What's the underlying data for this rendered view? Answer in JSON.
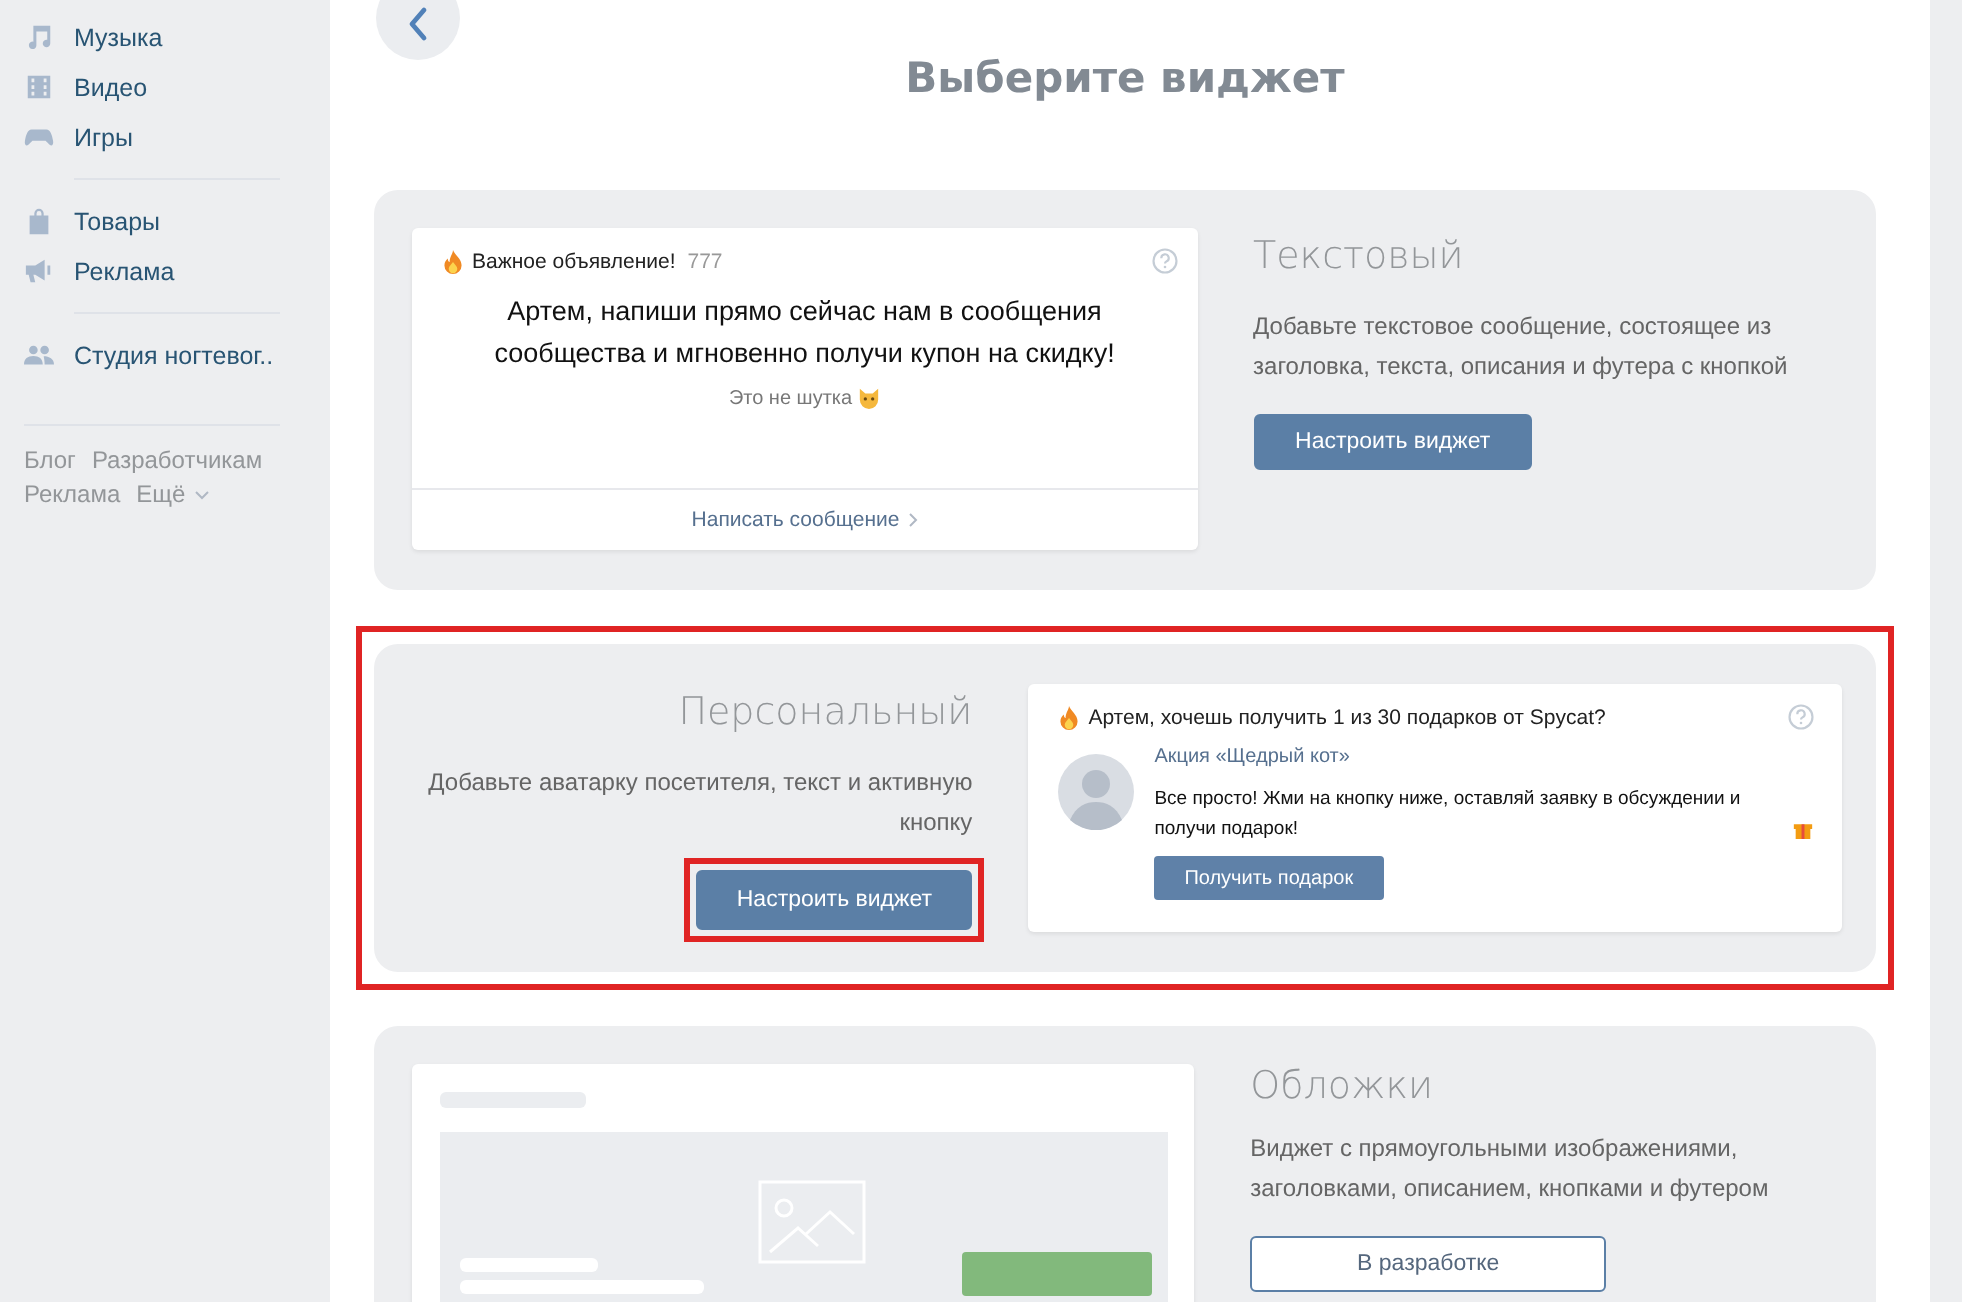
{
  "sidebar": {
    "groups": [
      {
        "items": [
          {
            "label": "Музыка"
          },
          {
            "label": "Видео"
          },
          {
            "label": "Игры"
          }
        ]
      },
      {
        "items": [
          {
            "label": "Товары"
          },
          {
            "label": "Реклама"
          }
        ]
      },
      {
        "items": [
          {
            "label": "Студия ногтевог.."
          }
        ]
      }
    ],
    "footer_links": [
      {
        "label": "Блог",
        "has_caret": false
      },
      {
        "label": "Разработчикам",
        "has_caret": false
      },
      {
        "label": "Реклама",
        "has_caret": false
      },
      {
        "label": "Ещё",
        "has_caret": true
      }
    ]
  },
  "page_title": "Выберите виджет",
  "widgets": [
    {
      "kind": "text",
      "highlighted": false,
      "title": "Текстовый",
      "description": "Добавьте текстовое сообщение, состоящее из заголовка, текста, описания и футера с кнопкой",
      "button": {
        "label": "Настроить виджет",
        "disabled": false,
        "highlighted": false
      },
      "preview": {
        "label": "Важное объявление!",
        "counter": "777",
        "headline": "Артем, напиши прямо сейчас нам в сообщения сообщества и мгновенно получи купон на скидку!",
        "subtext": "Это не шутка",
        "footer_link": "Написать сообщение"
      }
    },
    {
      "kind": "personal",
      "highlighted": true,
      "title": "Персональный",
      "description": "Добавьте аватарку посетителя, текст и активную кнопку",
      "button": {
        "label": "Настроить виджет",
        "disabled": false,
        "highlighted": true
      },
      "preview": {
        "heading": "Артем, хочешь получить 1 из 30 подарков от Spycat?",
        "name": "Акция «Щедрый кот»",
        "message": "Все просто! Жми на кнопку ниже, оставляй заявку в обсуждении и получи подарок!",
        "button": "Получить подарок"
      }
    },
    {
      "kind": "cover",
      "highlighted": false,
      "title": "Обложки",
      "description": "Виджет с прямоугольными изображениями, заголовками, описанием, кнопками и футером",
      "button": {
        "label": "В разработке",
        "disabled": true,
        "highlighted": false
      }
    }
  ]
}
